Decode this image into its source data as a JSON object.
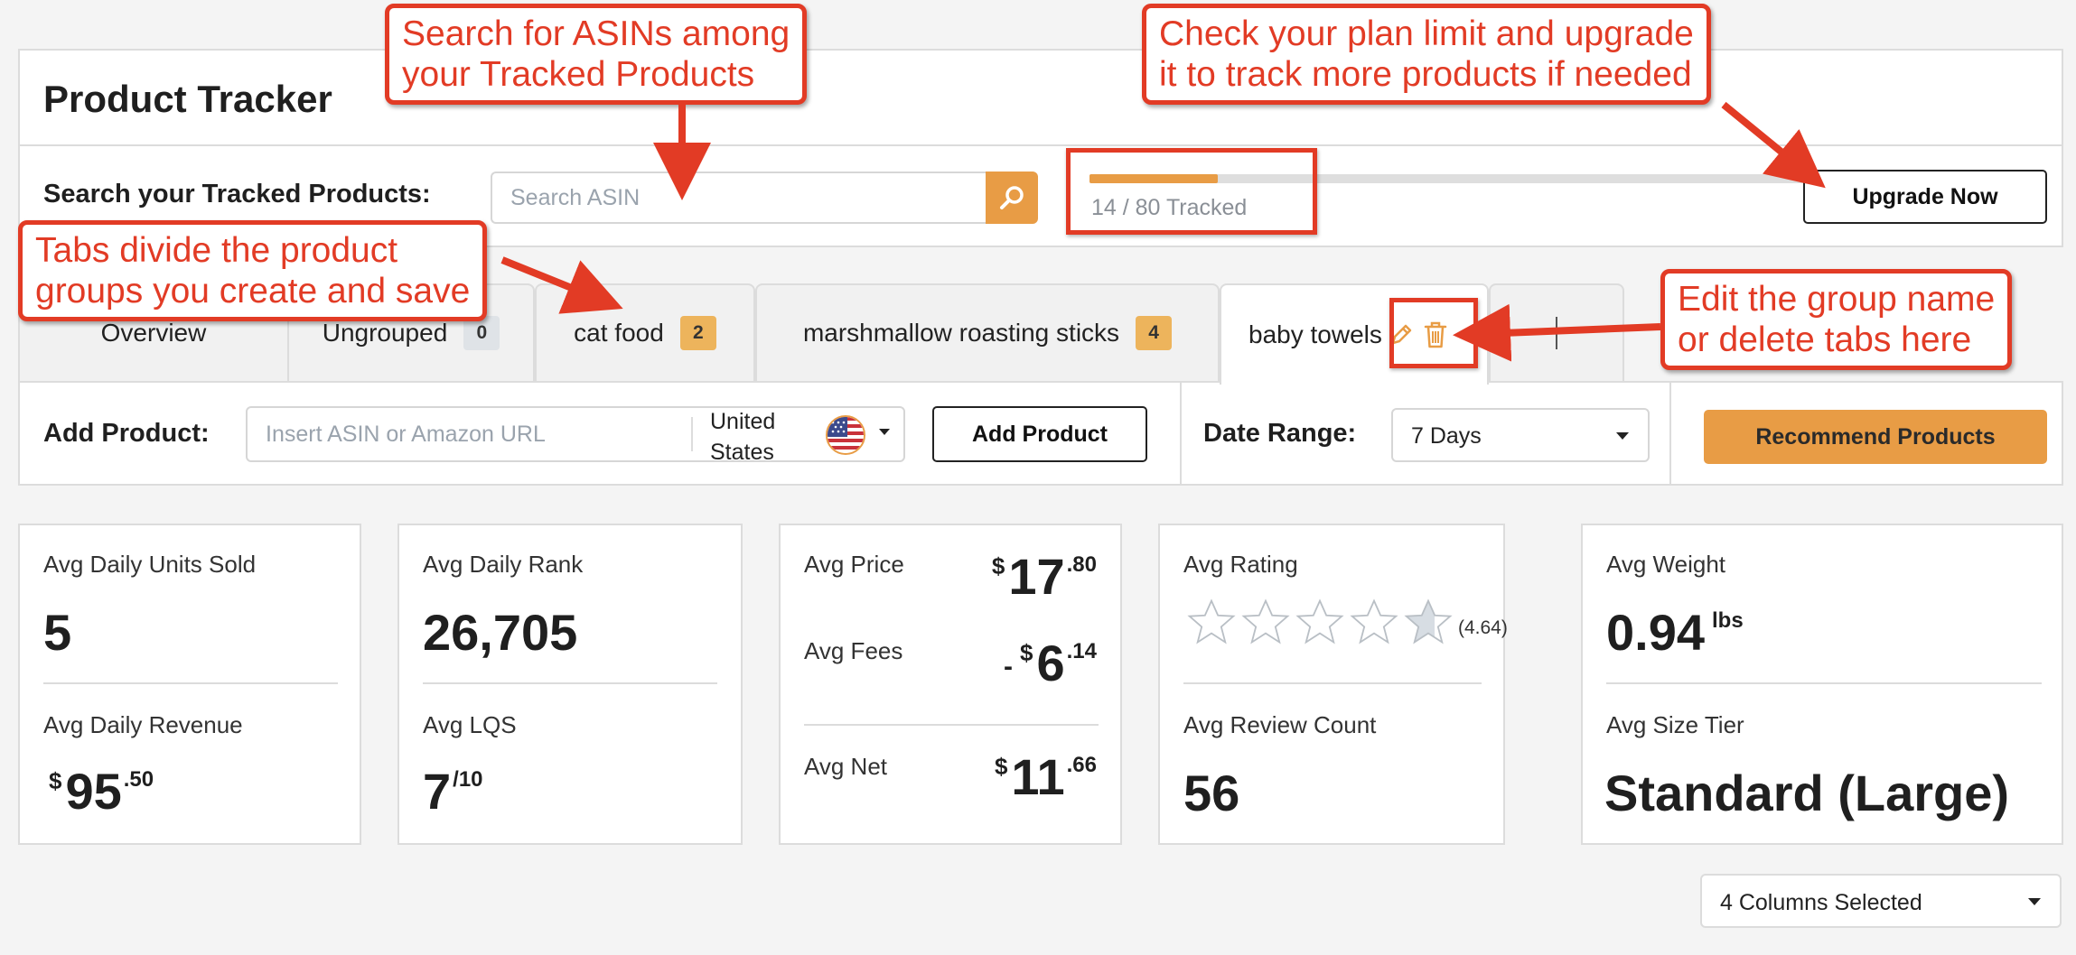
{
  "header": {
    "title": "Product Tracker",
    "search_label": "Search your Tracked Products:",
    "search_placeholder": "Search ASIN",
    "tracked_text": "14 / 80 Tracked",
    "tracked_count": 14,
    "tracked_limit": 80,
    "upgrade_label": "Upgrade Now"
  },
  "tabs": [
    {
      "label": "Overview"
    },
    {
      "label": "Ungrouped",
      "count": "0"
    },
    {
      "label": "cat food",
      "count": "2"
    },
    {
      "label": "marshmallow roasting sticks",
      "count": "4"
    },
    {
      "label": "baby towels",
      "active": true
    }
  ],
  "toolbar": {
    "add_label": "Add Product:",
    "asin_placeholder": "Insert ASIN or Amazon URL",
    "country": "United States",
    "add_button": "Add Product",
    "date_label": "Date Range:",
    "date_value": "7 Days",
    "recommend_button": "Recommend Products"
  },
  "metrics": {
    "units_label": "Avg Daily Units Sold",
    "units_value": "5",
    "revenue_label": "Avg Daily Revenue",
    "revenue_currency": "$",
    "revenue_whole": "95",
    "revenue_cents": ".50",
    "rank_label": "Avg Daily Rank",
    "rank_value": "26,705",
    "lqs_label": "Avg LQS",
    "lqs_value": "7",
    "lqs_max": "/10",
    "price_label": "Avg Price",
    "price_currency": "$",
    "price_whole": "17",
    "price_cents": ".80",
    "fees_label": "Avg Fees",
    "fees_sign": "-",
    "fees_currency": "$",
    "fees_whole": "6",
    "fees_cents": ".14",
    "net_label": "Avg Net",
    "net_currency": "$",
    "net_whole": "11",
    "net_cents": ".66",
    "rating_label": "Avg Rating",
    "rating_value": "(4.64)",
    "rating_stars": 4.64,
    "review_label": "Avg Review Count",
    "review_value": "56",
    "weight_label": "Avg Weight",
    "weight_value": "0.94",
    "weight_unit": "lbs",
    "size_label": "Avg Size Tier",
    "size_value": "Standard (Large)"
  },
  "columns_select": "4 Columns Selected",
  "annotations": {
    "search": "Search for ASINs among\nyour Tracked Products",
    "plan": "Check your plan limit and upgrade\nit to track more products if needed",
    "tabs": "Tabs divide the product\ngroups you create and save",
    "edit": "Edit the group name\nor delete tabs here"
  },
  "colors": {
    "accent": "#e89c45",
    "annotation": "#e23b25",
    "border": "#dcdcdc"
  },
  "icons": [
    "search-icon",
    "pencil-icon",
    "trash-icon",
    "plus-icon",
    "us-flag-icon",
    "caret-down-icon",
    "star-icon"
  ]
}
